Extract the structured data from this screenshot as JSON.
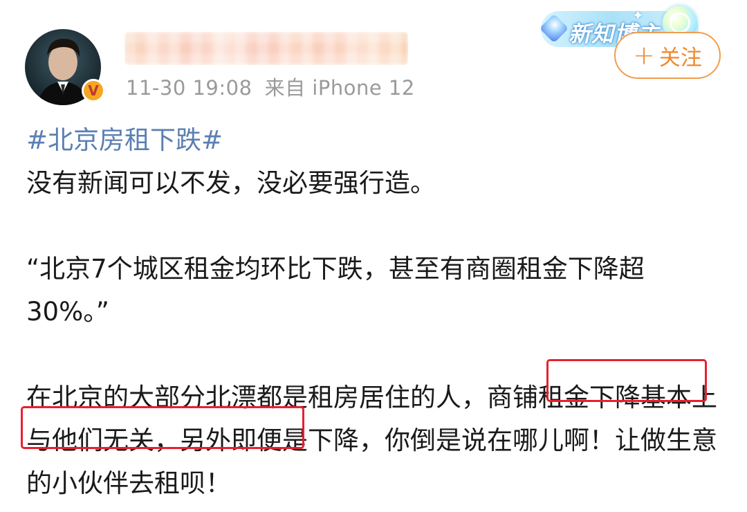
{
  "user": {
    "avatar_icon": "avatar-portrait",
    "verified_icon": "verified-v-icon",
    "verified_glyph": "V",
    "verified_color": "#f5a623"
  },
  "meta": {
    "time": "11-30 19:08",
    "source": "来自 iPhone 12"
  },
  "badge": {
    "text": "新知博主",
    "sparkle": "✦"
  },
  "follow_button": {
    "plus": "+",
    "label": "关注",
    "color": "#f08a2c"
  },
  "post": {
    "hashtag": "#北京房租下跌#",
    "line1": "没有新闻可以不发，没必要强行造。",
    "quote": "“北京7个城区租金均环比下跌，甚至有商圈租金下降超30%。”",
    "para3_a": "在北京的大部分北漂都是租房居住的人，",
    "para3_highlight": "商铺租金下降基本上与他们无关，",
    "para3_b": "另外即便是下降，你倒是说在哪儿啊！让做生意的小伙伴去租呗！"
  },
  "colors": {
    "hashtag": "#5b7fb3",
    "highlight_border": "#e8202e",
    "meta_gray": "#9a9a9a"
  }
}
